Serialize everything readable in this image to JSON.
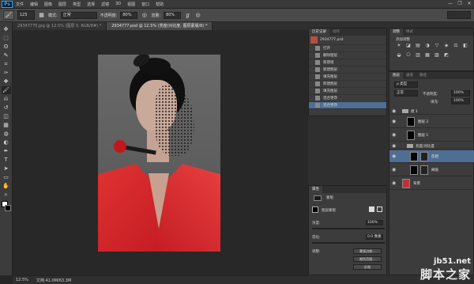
{
  "app": {
    "logo": "Ps",
    "menus": [
      "文件",
      "编辑",
      "图像",
      "图层",
      "类型",
      "选择",
      "滤镜",
      "3D",
      "视图",
      "窗口",
      "帮助"
    ],
    "window_controls": [
      "—",
      "❐",
      "✕"
    ]
  },
  "options": {
    "tool_icon": "brush-icon",
    "brush_size": "125",
    "mode_label": "模式:",
    "mode_value": "正常",
    "opacity_label": "不透明度:",
    "opacity_value": "80%",
    "flow_label": "流量:",
    "flow_value": "80%"
  },
  "tools": [
    "move-icon",
    "marquee-icon",
    "lasso-icon",
    "quick-select-icon",
    "crop-icon",
    "eyedropper-icon",
    "healing-icon",
    "brush-icon",
    "clone-stamp-icon",
    "history-brush-icon",
    "eraser-icon",
    "gradient-icon",
    "blur-icon",
    "dodge-icon",
    "pen-icon",
    "type-icon",
    "path-select-icon",
    "shape-icon",
    "hand-icon",
    "zoom-icon"
  ],
  "tool_glyphs": [
    "✥",
    "⬚",
    "ʘ",
    "✎",
    "⌗",
    "✑",
    "✚",
    "🖌",
    "⎌",
    "↺",
    "◫",
    "▦",
    "◍",
    "◐",
    "✒",
    "T",
    "➤",
    "▭",
    "✋",
    "⌕"
  ],
  "colors": {
    "foreground": "#ffffff",
    "background": "#000000",
    "brand": "#31a8ff"
  },
  "document": {
    "tabs": [
      {
        "label": "29347775.jpg @ 12.5% (图层 0, RGB/8#) *",
        "active": false
      },
      {
        "label": "2934777.psd @ 12.5% (亮度/对比度, 图层蒙版/8) *",
        "active": true
      }
    ],
    "zoom": "12.5%",
    "doc_info": "文档:41.0M/63.3M"
  },
  "history": {
    "tabs": [
      "历史记录",
      "动作"
    ],
    "snapshot": "2934777.psd",
    "items": [
      "打开",
      "删除图层",
      "新建组",
      "新建图层",
      "填充图层",
      "新建图层",
      "填充图层",
      "混合更改",
      "混合更改"
    ]
  },
  "adjustments": {
    "tabs": [
      "调整",
      "样式"
    ],
    "title": "添加调整",
    "icons": [
      "☀",
      "◪",
      "▤",
      "◑",
      "▽",
      "◈",
      "⚖",
      "◧",
      "◒",
      "⎔",
      "▥",
      "▦",
      "▧",
      "◩"
    ]
  },
  "layers": {
    "tabs": [
      "图层",
      "通道",
      "路径"
    ],
    "kind": "ρ 类型",
    "blend": "正常",
    "opacity_label": "不透明度:",
    "opacity_value": "100%",
    "fill_label": "填充:",
    "fill_value": "100%",
    "rows": [
      {
        "type": "group",
        "name": "组 1",
        "selected": false
      },
      {
        "type": "layer",
        "name": "图层 2",
        "selected": false
      },
      {
        "type": "layer",
        "name": "图层 1",
        "selected": false
      },
      {
        "type": "group",
        "name": "亮度/对比度",
        "selected": false
      },
      {
        "type": "adj",
        "name": "反相",
        "selected": true
      },
      {
        "type": "adj",
        "name": "阈值",
        "selected": false
      },
      {
        "type": "bg",
        "name": "背景",
        "selected": false
      }
    ]
  },
  "properties": {
    "tabs": [
      "属性"
    ],
    "section": "蒙版",
    "mask_label": "图层蒙版",
    "density_label": "浓度:",
    "density_value": "100%",
    "feather_label": "羽化:",
    "feather_value": "0.0 像素",
    "refine_label": "调整:",
    "buttons": [
      "蒙版边缘...",
      "颜色范围...",
      "反相"
    ]
  },
  "watermark": {
    "url": "jb51.net",
    "cn": "脚本之家"
  }
}
